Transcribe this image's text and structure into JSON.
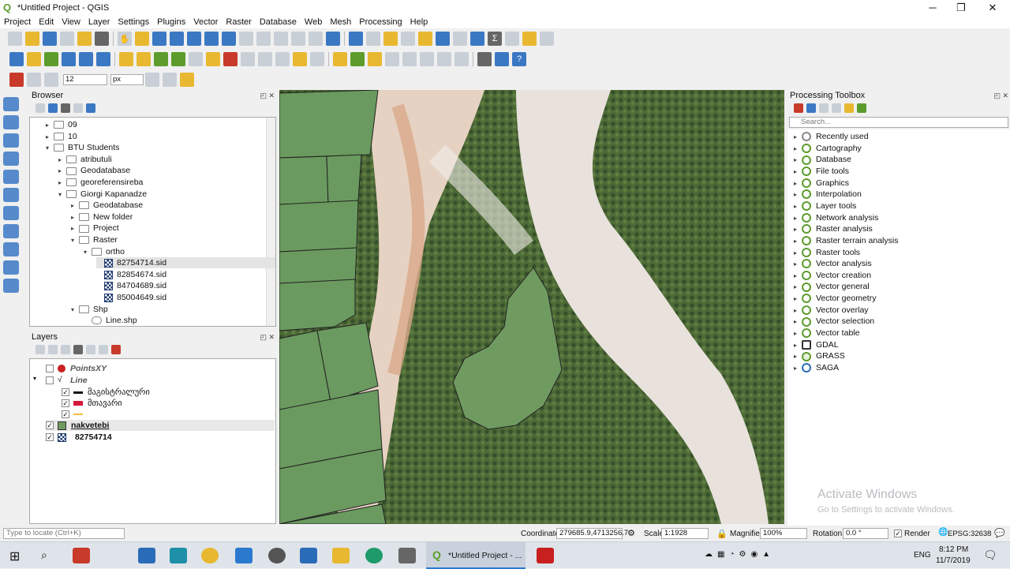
{
  "window": {
    "title": "*Untitled Project - QGIS",
    "min": "─",
    "max": "❐",
    "close": "✕"
  },
  "menu": [
    "Project",
    "Edit",
    "View",
    "Layer",
    "Settings",
    "Plugins",
    "Vector",
    "Raster",
    "Database",
    "Web",
    "Mesh",
    "Processing",
    "Help"
  ],
  "snapping": {
    "tolerance": "12",
    "unit": "px"
  },
  "browser": {
    "title": "Browser",
    "items": [
      {
        "label": "09",
        "depth": 2,
        "type": "folder",
        "arrow": "▸"
      },
      {
        "label": "10",
        "depth": 2,
        "type": "folder",
        "arrow": "▸"
      },
      {
        "label": "BTU Students",
        "depth": 2,
        "type": "folder",
        "arrow": "▾"
      },
      {
        "label": "atributuli",
        "depth": 3,
        "type": "folder",
        "arrow": "▸"
      },
      {
        "label": "Geodatabase",
        "depth": 3,
        "type": "folder",
        "arrow": "▸"
      },
      {
        "label": "georeferensireba",
        "depth": 3,
        "type": "folder",
        "arrow": "▸"
      },
      {
        "label": "Giorgi Kapanadze",
        "depth": 3,
        "type": "folder",
        "arrow": "▾"
      },
      {
        "label": "Geodatabase",
        "depth": 4,
        "type": "folder",
        "arrow": "▸"
      },
      {
        "label": "New folder",
        "depth": 4,
        "type": "folder",
        "arrow": "▸"
      },
      {
        "label": "Project",
        "depth": 4,
        "type": "folder",
        "arrow": "▸"
      },
      {
        "label": "Raster",
        "depth": 4,
        "type": "folder",
        "arrow": "▾"
      },
      {
        "label": "ortho",
        "depth": 5,
        "type": "folder",
        "arrow": "▾"
      },
      {
        "label": "82754714.sid",
        "depth": 6,
        "type": "sid",
        "arrow": ""
      },
      {
        "label": "82854674.sid",
        "depth": 6,
        "type": "sid",
        "arrow": ""
      },
      {
        "label": "84704689.sid",
        "depth": 6,
        "type": "sid",
        "arrow": ""
      },
      {
        "label": "85004649.sid",
        "depth": 6,
        "type": "sid",
        "arrow": ""
      },
      {
        "label": "Shp",
        "depth": 4,
        "type": "folder",
        "arrow": "▾"
      },
      {
        "label": "Line.shp",
        "depth": 5,
        "type": "line",
        "arrow": ""
      }
    ]
  },
  "layers": {
    "title": "Layers",
    "items": [
      {
        "label": "PointsXY",
        "italic": true,
        "checked": false,
        "symbol": "point"
      },
      {
        "label": "Line",
        "italic": true,
        "checked": false,
        "symbol": "linegroup"
      },
      {
        "label": "მაგისტრალური",
        "italic": false,
        "checked": true,
        "symbol": "black-line"
      },
      {
        "label": "მთავარი",
        "italic": false,
        "checked": true,
        "symbol": "red-line"
      },
      {
        "label": "",
        "italic": false,
        "checked": true,
        "symbol": "yellow-line"
      },
      {
        "label": "nakvetebi",
        "italic": false,
        "checked": true,
        "symbol": "green-fill",
        "bold": true
      },
      {
        "label": "82754714",
        "italic": false,
        "checked": true,
        "symbol": "raster",
        "bold": true
      }
    ]
  },
  "processing": {
    "title": "Processing Toolbox",
    "search_placeholder": "Search...",
    "items": [
      "Recently used",
      "Cartography",
      "Database",
      "File tools",
      "Graphics",
      "Interpolation",
      "Layer tools",
      "Network analysis",
      "Raster analysis",
      "Raster terrain analysis",
      "Raster tools",
      "Vector analysis",
      "Vector creation",
      "Vector general",
      "Vector geometry",
      "Vector overlay",
      "Vector selection",
      "Vector table",
      "GDAL",
      "GRASS",
      "SAGA"
    ]
  },
  "status": {
    "locate_placeholder": "Type to locate (Ctrl+K)",
    "coordinate_label": "Coordinate",
    "coordinate": "279685.9,4713256.7",
    "scale_label": "Scale",
    "scale": "1:1928",
    "magnifier_label": "Magnifier",
    "magnifier": "100%",
    "rotation_label": "Rotation",
    "rotation": "0.0 °",
    "render_label": "Render",
    "crs": "EPSG:32638"
  },
  "watermark": {
    "line1": "Activate Windows",
    "line2": "Go to Settings to activate Windows."
  },
  "taskbar": {
    "active_app": "*Untitled Project - ...",
    "time": "8:12 PM",
    "date": "11/7/2019",
    "lang": "ENG"
  }
}
